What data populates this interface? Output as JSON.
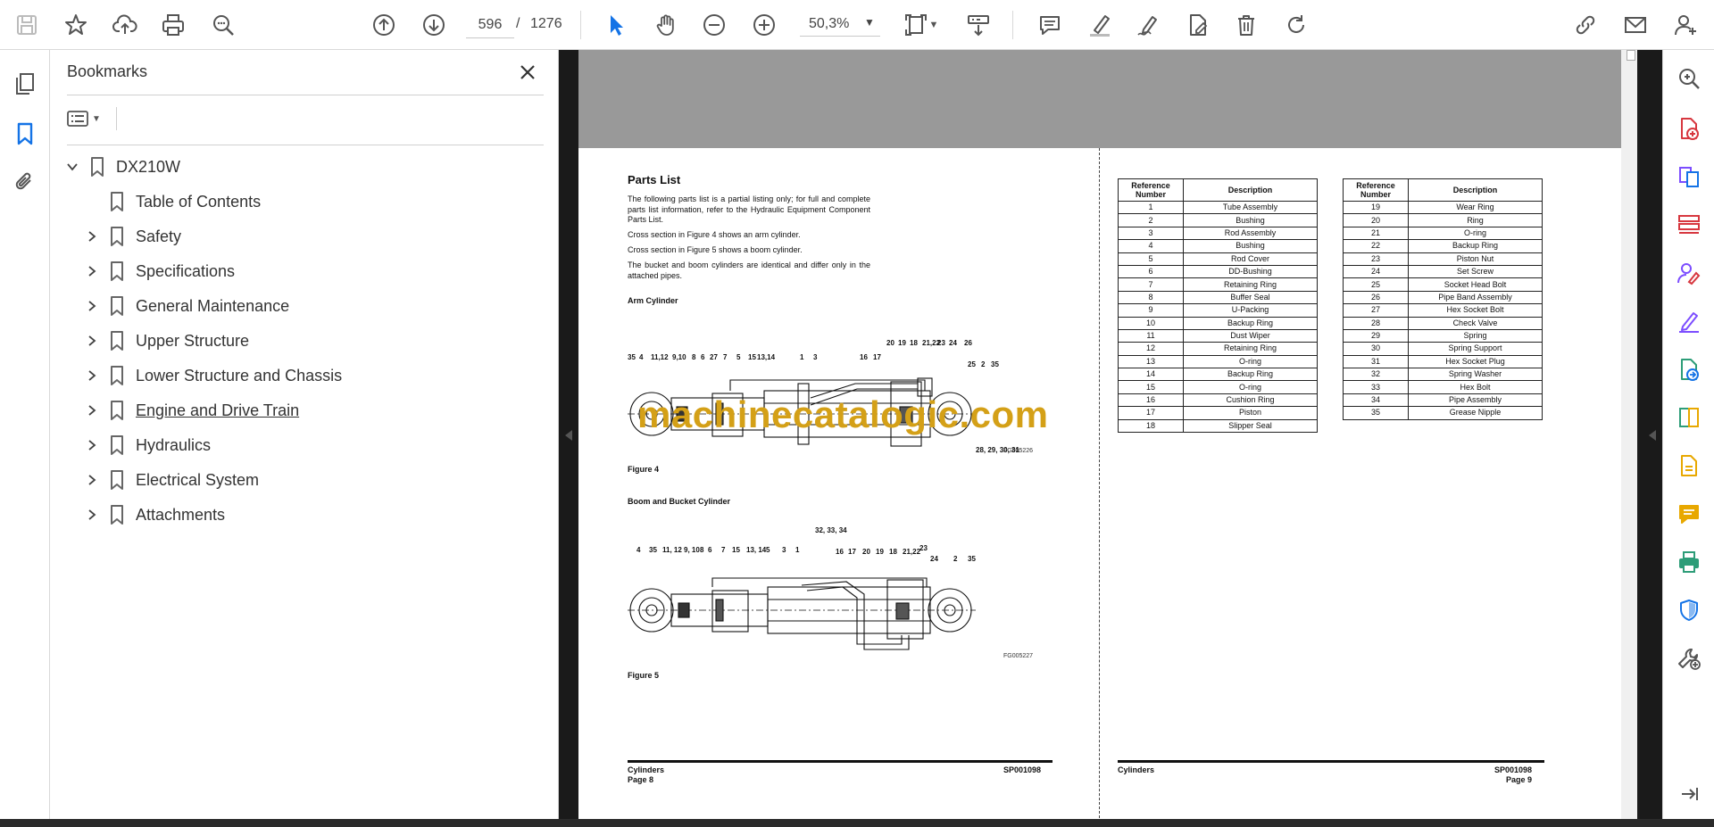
{
  "toolbar": {
    "current_page": "596",
    "page_separator": "/",
    "total_pages": "1276",
    "zoom": "50,3%"
  },
  "bookmarks_panel": {
    "title": "Bookmarks",
    "root": "DX210W",
    "items": [
      {
        "label": "Table of Contents",
        "expandable": false
      },
      {
        "label": "Safety",
        "expandable": true
      },
      {
        "label": "Specifications",
        "expandable": true
      },
      {
        "label": "General Maintenance",
        "expandable": true
      },
      {
        "label": "Upper Structure",
        "expandable": true
      },
      {
        "label": "Lower Structure and Chassis",
        "expandable": true
      },
      {
        "label": "Engine and Drive Train",
        "expandable": true
      },
      {
        "label": "Hydraulics",
        "expandable": true
      },
      {
        "label": "Electrical System",
        "expandable": true
      },
      {
        "label": "Attachments",
        "expandable": true
      }
    ]
  },
  "document": {
    "left_page": {
      "heading": "Parts List",
      "paragraphs": [
        "The following parts list is a partial listing only; for full and complete parts list information, refer to the Hydraulic Equipment Component Parts List.",
        "Cross section in Figure 4 shows an arm cylinder.",
        "Cross section in Figure 5 shows a boom cylinder.",
        "The bucket and boom cylinders are identical and differ only in the attached pipes."
      ],
      "fig4_title": "Arm Cylinder",
      "fig4_caption": "Figure 4",
      "fig4_id": "FG005226",
      "fig4_callouts": [
        "35",
        "4",
        "11,12",
        "9,10",
        "8",
        "6",
        "27",
        "7",
        "5",
        "15",
        "13,14",
        "1",
        "3",
        "16",
        "17",
        "20",
        "19",
        "18",
        "21,22",
        "23",
        "24",
        "26",
        "25",
        "2",
        "35",
        "28, 29, 30, 31"
      ],
      "fig5_title": "Boom and Bucket Cylinder",
      "fig5_caption": "Figure 5",
      "fig5_id": "FG005227",
      "fig5_callouts": [
        "4",
        "35",
        "11, 12",
        "9, 10",
        "8",
        "6",
        "7",
        "15",
        "13, 14",
        "5",
        "3",
        "1",
        "32, 33, 34",
        "16",
        "17",
        "20",
        "19",
        "18",
        "21,22",
        "23",
        "24",
        "2",
        "35"
      ],
      "footer_left": "Cylinders",
      "footer_page": "Page 8",
      "footer_code": "SP001098"
    },
    "right_page": {
      "col_ref": "Reference Number",
      "col_desc": "Description",
      "table_a": [
        [
          "1",
          "Tube Assembly"
        ],
        [
          "2",
          "Bushing"
        ],
        [
          "3",
          "Rod Assembly"
        ],
        [
          "4",
          "Bushing"
        ],
        [
          "5",
          "Rod Cover"
        ],
        [
          "6",
          "DD-Bushing"
        ],
        [
          "7",
          "Retaining Ring"
        ],
        [
          "8",
          "Buffer Seal"
        ],
        [
          "9",
          "U-Packing"
        ],
        [
          "10",
          "Backup Ring"
        ],
        [
          "11",
          "Dust Wiper"
        ],
        [
          "12",
          "Retaining Ring"
        ],
        [
          "13",
          "O-ring"
        ],
        [
          "14",
          "Backup Ring"
        ],
        [
          "15",
          "O-ring"
        ],
        [
          "16",
          "Cushion Ring"
        ],
        [
          "17",
          "Piston"
        ],
        [
          "18",
          "Slipper Seal"
        ]
      ],
      "table_b": [
        [
          "19",
          "Wear Ring"
        ],
        [
          "20",
          "Ring"
        ],
        [
          "21",
          "O-ring"
        ],
        [
          "22",
          "Backup Ring"
        ],
        [
          "23",
          "Piston Nut"
        ],
        [
          "24",
          "Set Screw"
        ],
        [
          "25",
          "Socket Head Bolt"
        ],
        [
          "26",
          "Pipe Band Assembly"
        ],
        [
          "27",
          "Hex Socket Bolt"
        ],
        [
          "28",
          "Check Valve"
        ],
        [
          "29",
          "Spring"
        ],
        [
          "30",
          "Spring Support"
        ],
        [
          "31",
          "Hex Socket Plug"
        ],
        [
          "32",
          "Spring Washer"
        ],
        [
          "33",
          "Hex Bolt"
        ],
        [
          "34",
          "Pipe Assembly"
        ],
        [
          "35",
          "Grease Nipple"
        ]
      ],
      "footer_left": "Cylinders",
      "footer_page": "Page 9",
      "footer_code": "SP001098"
    }
  },
  "watermark": "machinecatalogic.com",
  "colors": {
    "accent_blue": "#1473e6",
    "rail_icon_pink": "#d7373f",
    "rail_icon_purple": "#7c4dff",
    "rail_icon_green": "#2d9d78",
    "rail_icon_yellow": "#e8a800",
    "watermark": "#d4a017"
  }
}
